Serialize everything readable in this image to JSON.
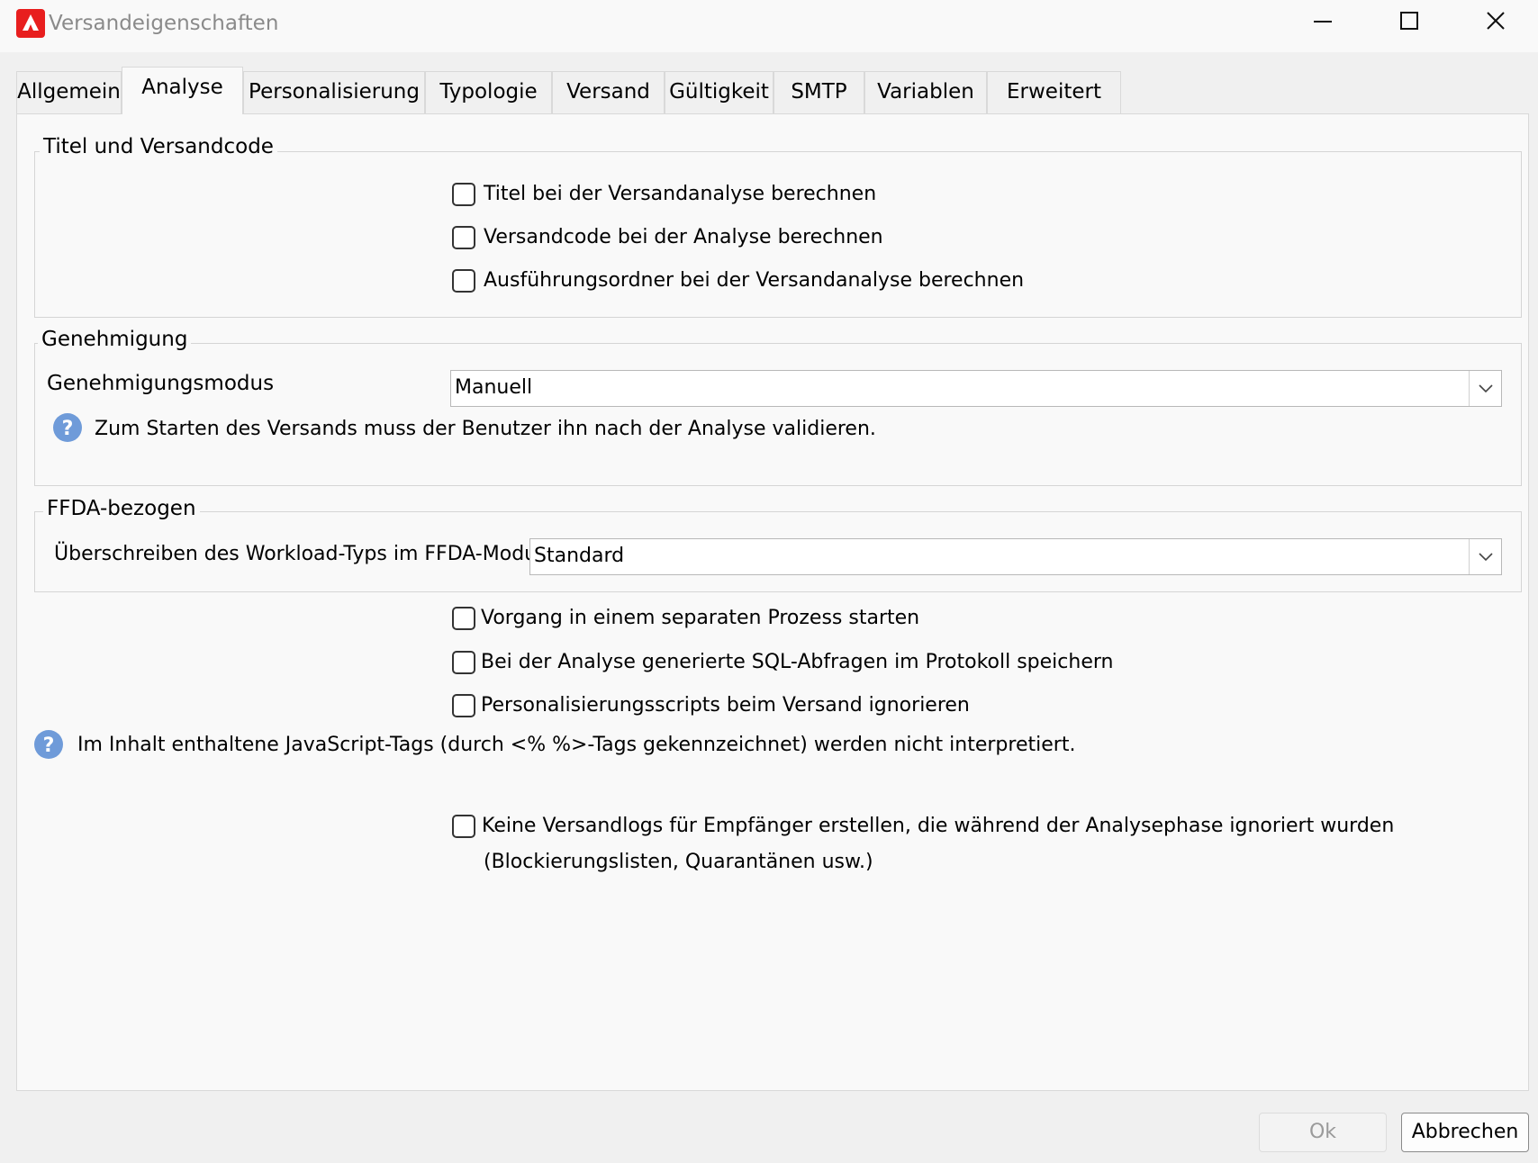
{
  "window": {
    "title": "Versandeigenschaften"
  },
  "tabs": [
    {
      "label": "Allgemein"
    },
    {
      "label": "Analyse"
    },
    {
      "label": "Personalisierung"
    },
    {
      "label": "Typologie"
    },
    {
      "label": "Versand"
    },
    {
      "label": "Gültigkeit"
    },
    {
      "label": "SMTP"
    },
    {
      "label": "Variablen"
    },
    {
      "label": "Erweitert"
    }
  ],
  "title_code_group": {
    "legend": "Titel und Versandcode",
    "options": [
      {
        "label": "Titel bei der Versandanalyse berechnen",
        "checked": false
      },
      {
        "label": "Versandcode bei der Analyse berechnen",
        "checked": false
      },
      {
        "label": "Ausführungsordner bei der Versandanalyse berechnen",
        "checked": false
      }
    ]
  },
  "approval_group": {
    "legend": "Genehmigung",
    "mode_label": "Genehmigungsmodus",
    "mode_value": "Manuell",
    "hint": "Zum Starten des Versands muss der Benutzer ihn nach der Analyse validieren."
  },
  "ffda_group": {
    "legend": "FFDA-bezogen",
    "workload_label": "Überschreiben des Workload-Typs im FFDA-Modus:",
    "workload_value": "Standard"
  },
  "options": [
    {
      "label": "Vorgang in einem separaten Prozess starten",
      "checked": false
    },
    {
      "label": "Bei der Analyse generierte SQL-Abfragen im Protokoll speichern",
      "checked": false
    },
    {
      "label": "Personalisierungsscripts beim Versand ignorieren",
      "checked": false
    }
  ],
  "js_hint": "Im Inhalt enthaltene JavaScript-Tags (durch <% %>-Tags gekennzeichnet) werden nicht interpretiert.",
  "no_logs": {
    "label_line1": "Keine Versandlogs für Empfänger erstellen, die während der Analysephase ignoriert wurden",
    "label_line2": "(Blockierungslisten, Quarantänen usw.)",
    "checked": false
  },
  "footer": {
    "ok_label": "Ok",
    "cancel_label": "Abbrechen"
  },
  "colors": {
    "app_icon": "#e81e1e",
    "help_icon": "#6f9bd9"
  }
}
